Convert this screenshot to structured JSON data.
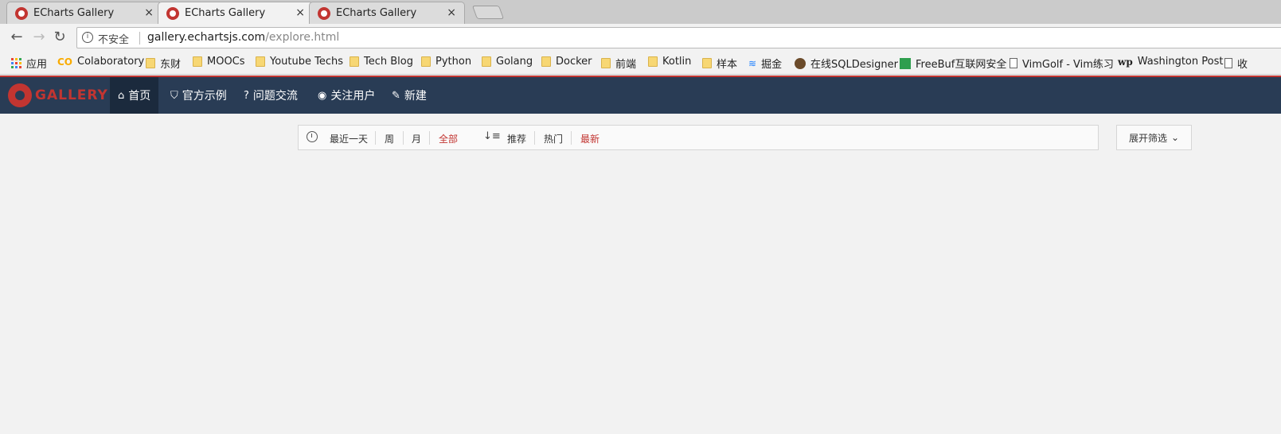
{
  "browser": {
    "tabs": [
      {
        "title": "ECharts Gallery",
        "close": "×"
      },
      {
        "title": "ECharts Gallery",
        "close": "×"
      },
      {
        "title": "ECharts Gallery",
        "close": "×"
      }
    ],
    "address": {
      "security_label": "不安全",
      "host": "gallery.echartsjs.com",
      "path": "/explore.html"
    },
    "bookmarks": [
      {
        "label": "应用",
        "icon": "apps-grid-icon"
      },
      {
        "label": "Colaboratory",
        "icon": "colab-icon"
      },
      {
        "label": "东财",
        "icon": "folder-icon"
      },
      {
        "label": "MOOCs",
        "icon": "folder-icon"
      },
      {
        "label": "Youtube Techs",
        "icon": "folder-icon"
      },
      {
        "label": "Tech Blog",
        "icon": "folder-icon"
      },
      {
        "label": "Python",
        "icon": "folder-icon"
      },
      {
        "label": "Golang",
        "icon": "folder-icon"
      },
      {
        "label": "Docker",
        "icon": "folder-icon"
      },
      {
        "label": "前端",
        "icon": "folder-icon"
      },
      {
        "label": "Kotlin",
        "icon": "folder-icon"
      },
      {
        "label": "样本",
        "icon": "folder-icon"
      },
      {
        "label": "掘金",
        "icon": "juejin-icon"
      },
      {
        "label": "在线SQLDesigner",
        "icon": "avatar-icon"
      },
      {
        "label": "FreeBuf互联网安全",
        "icon": "freebuf-icon"
      },
      {
        "label": "VimGolf - Vim练习",
        "icon": "page-icon"
      },
      {
        "label": "Washington Post",
        "icon": "wp-icon"
      },
      {
        "label": "收",
        "icon": "page-icon"
      }
    ]
  },
  "app": {
    "logo_text": "GALLERY",
    "nav": [
      {
        "label": "首页",
        "icon": "home-icon"
      },
      {
        "label": "官方示例",
        "icon": "shield-icon"
      },
      {
        "label": "问题交流",
        "icon": "question-icon"
      },
      {
        "label": "关注用户",
        "icon": "eye-icon"
      },
      {
        "label": "新建",
        "icon": "edit-icon"
      }
    ],
    "filters": {
      "time": [
        "最近一天",
        "周",
        "月",
        "全部"
      ],
      "sort": [
        "推荐",
        "热门",
        "最新"
      ],
      "expand_label": "展开筛选"
    }
  },
  "colors": {
    "brand_red": "#c23531",
    "header_bg": "#293c55"
  }
}
